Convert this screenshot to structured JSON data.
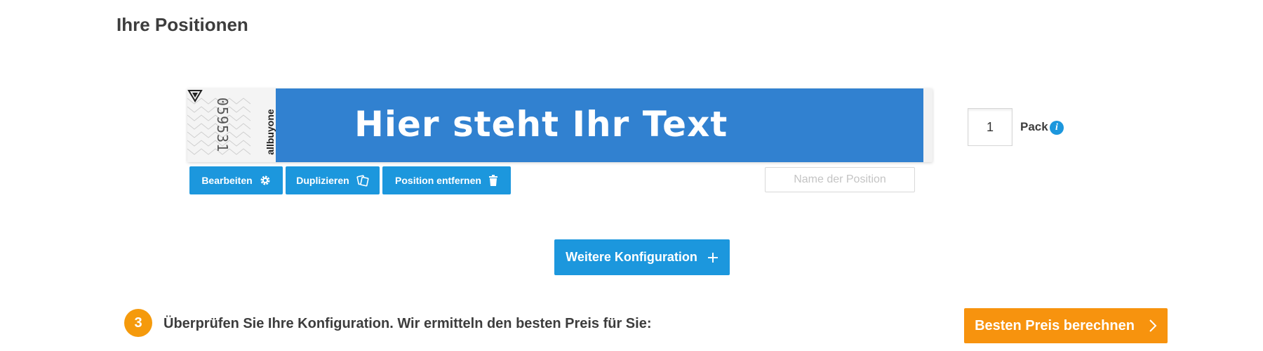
{
  "section_title": "Ihre Positionen",
  "wristband": {
    "serial": "059531",
    "brand": "allbuyone",
    "print_text": "Hier steht Ihr Text",
    "band_color": "#3181d0"
  },
  "actions": {
    "edit_label": "Bearbeiten",
    "edit_icon": "gear-icon",
    "duplicate_label": "Duplizieren",
    "duplicate_icon": "duplicate-icon",
    "remove_label": "Position entfernen",
    "remove_icon": "trash-icon"
  },
  "position_name": {
    "value": "",
    "placeholder": "Name der Position"
  },
  "quantity": {
    "value": "1",
    "unit": "Pack",
    "info_icon": "info-icon"
  },
  "more_config": {
    "label": "Weitere Konfiguration",
    "icon": "plus-icon"
  },
  "step": {
    "number": "3",
    "text": "Überprüfen Sie Ihre Konfiguration. Wir ermitteln den besten Preis für Sie:"
  },
  "calculate": {
    "label": "Besten Preis berechnen",
    "icon": "chevron-right-icon"
  },
  "colors": {
    "accent_blue": "#1c97dd",
    "accent_orange": "#f7930e"
  }
}
